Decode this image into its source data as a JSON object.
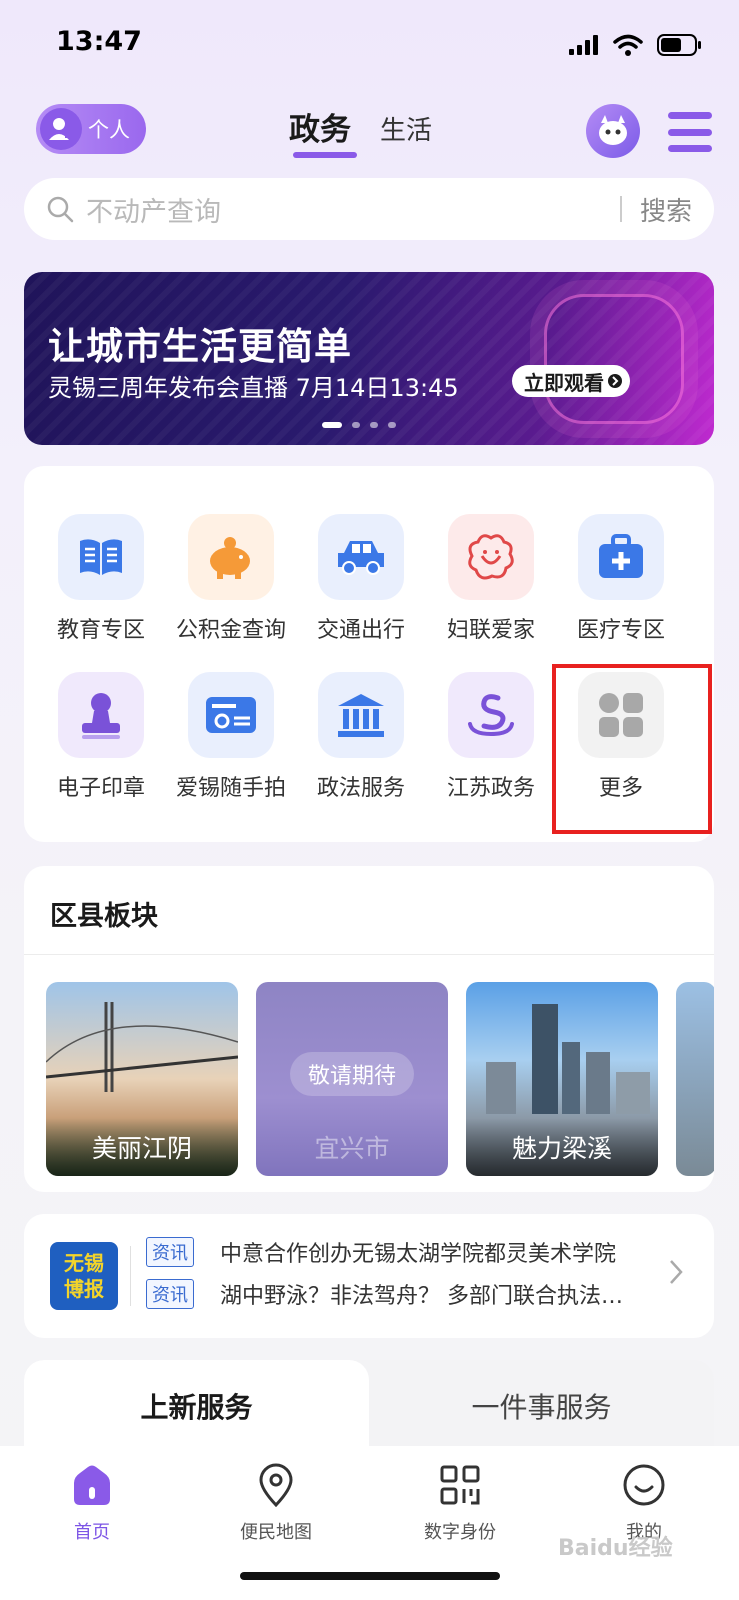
{
  "status_bar": {
    "time": "13:47"
  },
  "header": {
    "persona_label": "个人",
    "tabs": [
      {
        "label": "政务",
        "active": true
      },
      {
        "label": "生活",
        "active": false
      }
    ]
  },
  "search": {
    "placeholder": "不动产查询",
    "button_label": "搜索"
  },
  "banner": {
    "title": "让城市生活更简单",
    "subtitle": "灵锡三周年发布会直播 7月14日13:45",
    "cta_label": "立即观看",
    "slide_count": 4,
    "active_slide": 1
  },
  "services": {
    "items": [
      {
        "label": "教育专区",
        "icon": "book-icon"
      },
      {
        "label": "公积金查询",
        "icon": "piggy-bank-icon"
      },
      {
        "label": "交通出行",
        "icon": "car-icon"
      },
      {
        "label": "妇联爱家",
        "icon": "flower-logo-icon"
      },
      {
        "label": "医疗专区",
        "icon": "medical-kit-icon"
      },
      {
        "label": "电子印章",
        "icon": "stamp-icon"
      },
      {
        "label": "爱锡随手拍",
        "icon": "camera-card-icon"
      },
      {
        "label": "政法服务",
        "icon": "courthouse-icon"
      },
      {
        "label": "江苏政务",
        "icon": "jiangsu-logo-icon"
      },
      {
        "label": "更多",
        "icon": "grid-more-icon"
      }
    ]
  },
  "district": {
    "title": "区县板块",
    "tiles": [
      {
        "label": "美丽江阴"
      },
      {
        "label": "宜兴市",
        "overlay": "敬请期待"
      },
      {
        "label": "魅力梁溪"
      }
    ]
  },
  "news": {
    "logo_line1": "无锡",
    "logo_line2": "博报",
    "items": [
      {
        "tag": "资讯",
        "text": "中意合作创办无锡太湖学院都灵美术学院"
      },
      {
        "tag": "资讯",
        "text": "湖中野泳？非法驾舟？ 多部门联合执法…"
      }
    ]
  },
  "service_tabs": {
    "new_label": "上新服务",
    "onething_label": "一件事服务"
  },
  "bottom_nav": {
    "items": [
      {
        "label": "首页",
        "active": true
      },
      {
        "label": "便民地图",
        "active": false
      },
      {
        "label": "数字身份",
        "active": false
      },
      {
        "label": "我的",
        "active": false
      }
    ]
  },
  "watermark": "Baidu经验",
  "colors": {
    "accent": "#8a5ae8",
    "highlight": "#e8211f",
    "news_blue": "#3a6bd0"
  }
}
